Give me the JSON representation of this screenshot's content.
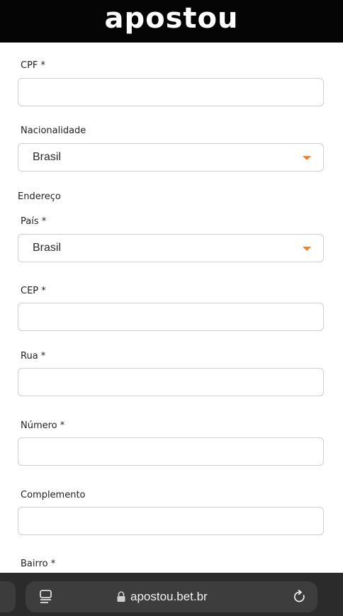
{
  "header": {
    "logo_text": "apostou"
  },
  "form": {
    "cpf_label": "CPF *",
    "nacionalidade_label": "Nacionalidade",
    "nacionalidade_value": "Brasil",
    "endereco_section": "Endereço",
    "pais_label": "País *",
    "pais_value": "Brasil",
    "cep_label": "CEP *",
    "rua_label": "Rua *",
    "numero_label": "Número *",
    "complemento_label": "Complemento",
    "bairro_label": "Bairro *"
  },
  "browser": {
    "url": "apostou.bet.br"
  },
  "colors": {
    "accent": "#e8833a",
    "header_bg": "#050505",
    "browser_bar": "#2b2b2b"
  },
  "icons": [
    "dropdown-caret-icon",
    "tabs-icon",
    "lock-icon",
    "reload-icon"
  ]
}
